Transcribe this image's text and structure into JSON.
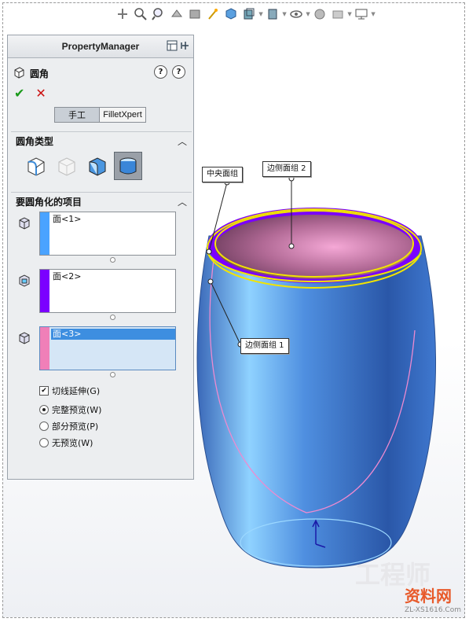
{
  "property_manager": {
    "title": "PropertyManager",
    "feature_name": "圆角",
    "help_label": "?",
    "info_label": "?",
    "ok_label": "✔",
    "cancel_label": "✕",
    "tabs": [
      {
        "label": "手工",
        "active": true
      },
      {
        "label": "FilletXpert",
        "active": false
      }
    ],
    "fillet_type": {
      "title": "圆角类型",
      "collapse_icon": "chevron-up-icon",
      "types": [
        "constant-radius-fillet-icon",
        "variable-radius-fillet-icon",
        "face-fillet-icon",
        "full-round-fillet-icon"
      ],
      "selected": "full-round-fillet-icon"
    },
    "items_to_fillet": {
      "title": "要圆角化的项目",
      "collapse_icon": "chevron-up-icon",
      "groups": [
        {
          "name": "side-face-set-1",
          "item": "面<1>",
          "color": "#4aa3ff",
          "highlighted": false
        },
        {
          "name": "center-face-set",
          "item": "面<2>",
          "color": "#7b00ff",
          "highlighted": false
        },
        {
          "name": "side-face-set-2",
          "item": "面<3>",
          "color": "#f07fb8",
          "highlighted": true
        }
      ]
    },
    "options": {
      "tangent_propagation": {
        "label": "切线延伸(G)",
        "checked": true
      },
      "preview": {
        "choices": [
          "完整预览(W)",
          "部分预览(P)",
          "无预览(W)"
        ],
        "selected": "完整预览(W)"
      }
    }
  },
  "callouts": {
    "center_face_set": "中央面组",
    "side_face_set_2": "边侧面组 2",
    "side_face_set_1": "边侧面组 1"
  },
  "watermark": {
    "brand": "资料网",
    "url": "ZL-XS1616.Com"
  },
  "colors": {
    "model_blue": "#3f7fd6",
    "inner_pink": "#c8709a",
    "highlight_yellow": "#f2e400",
    "highlight_purple": "#7b00ff"
  }
}
